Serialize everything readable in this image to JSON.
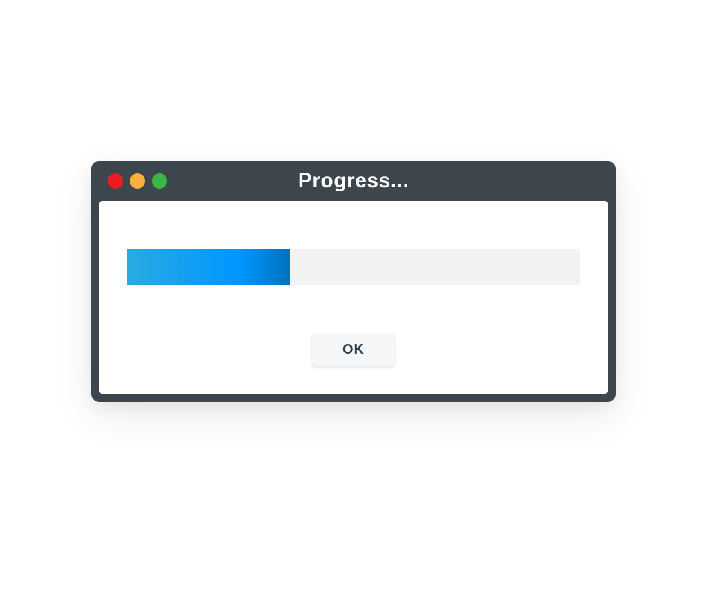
{
  "window": {
    "title": "Progress..."
  },
  "progress": {
    "percent": 36
  },
  "button": {
    "ok_label": "OK"
  }
}
